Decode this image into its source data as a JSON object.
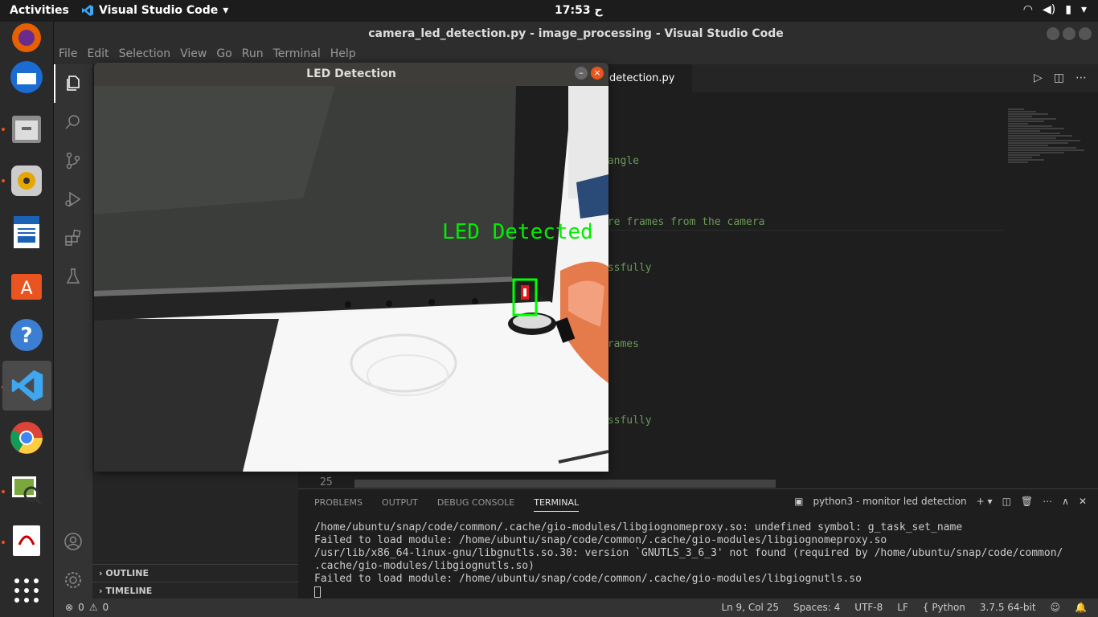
{
  "topbar": {
    "activities": "Activities",
    "app_name": "Visual Studio Code",
    "clock": "17:53 ح"
  },
  "window": {
    "title": "camera_led_detection.py - image_processing - Visual Studio Code"
  },
  "menu": [
    "File",
    "Edit",
    "Selection",
    "View",
    "Go",
    "Run",
    "Terminal",
    "Help"
  ],
  "editor": {
    "tab_label": "detection.py",
    "visible_fragments": [
      "tangle",
      "ure frames from the camera",
      "essfully",
      "frames",
      "essfully"
    ],
    "line_number": "25"
  },
  "sidebar": {
    "outline": "OUTLINE",
    "timeline": "TIMELINE"
  },
  "panel": {
    "tabs": [
      "PROBLEMS",
      "OUTPUT",
      "DEBUG CONSOLE",
      "TERMINAL"
    ],
    "terminal_name": "python3 - monitor led detection",
    "lines": [
      "/home/ubuntu/snap/code/common/.cache/gio-modules/libgiognomeproxy.so: undefined symbol: g_task_set_name",
      "Failed to load module: /home/ubuntu/snap/code/common/.cache/gio-modules/libgiognomeproxy.so",
      "/usr/lib/x86_64-linux-gnu/libgnutls.so.30: version `GNUTLS_3_6_3' not found (required by /home/ubuntu/snap/code/common/",
      ".cache/gio-modules/libgiognutls.so)",
      "Failed to load module: /home/ubuntu/snap/code/common/.cache/gio-modules/libgiognutls.so"
    ]
  },
  "status": {
    "errors": "0",
    "warnings": "0",
    "position": "Ln 9, Col 25",
    "spaces": "Spaces: 4",
    "encoding": "UTF-8",
    "eol": "LF",
    "language": "Python",
    "interpreter": "3.7.5 64-bit"
  },
  "led_window": {
    "title": "LED Detection",
    "overlay_text": "LED Detected"
  }
}
